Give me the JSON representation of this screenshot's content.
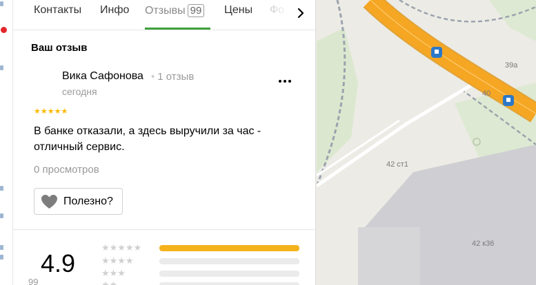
{
  "tabs": [
    {
      "label": "Контакты"
    },
    {
      "label": "Инфо"
    },
    {
      "label": "Отзывы",
      "badge": "99"
    },
    {
      "label": "Цены"
    },
    {
      "label": "Фо"
    }
  ],
  "review": {
    "section_title": "Ваш отзыв",
    "author": "Вика Сафонова",
    "author_reviews": "1 отзыв",
    "date": "сегодня",
    "rating_stars": 5,
    "stars_text": "★★★★★",
    "text": "В банке отказали, а здесь выручили за час - отличный сервис.",
    "views": "0 просмотров",
    "helpful_label": "Полезно?",
    "more_label": "..."
  },
  "summary": {
    "rating": "4.9",
    "sub_text": "99",
    "rows": [
      {
        "stars": "★★★★★",
        "fill": 1.0
      },
      {
        "stars": "★★★★",
        "fill": 0.0
      },
      {
        "stars": "★★★",
        "fill": 0.0
      },
      {
        "stars": "★★",
        "fill": 0.0
      }
    ]
  },
  "map": {
    "labels": [
      "39а",
      "40",
      "42 ст1",
      "42 к36"
    ]
  },
  "colors": {
    "accent_green": "#3ca03c",
    "star_gold": "#fcb900",
    "road_orange": "#f5a623",
    "bar_fill": "#f5b21c",
    "metro_blue": "#2c78c8"
  }
}
